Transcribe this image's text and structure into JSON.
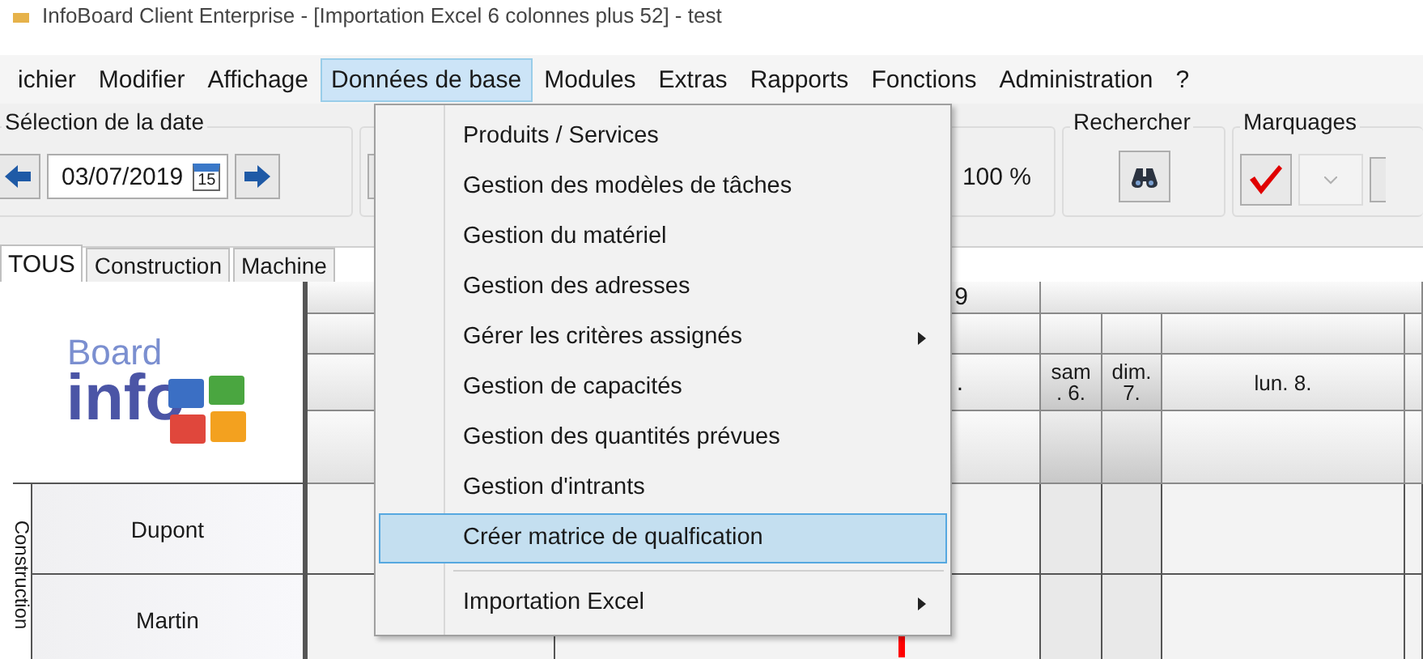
{
  "window": {
    "title": "InfoBoard Client Enterprise - [Importation Excel 6 colonnes plus 52] - test"
  },
  "menu_bar": [
    {
      "label": "ichier",
      "selected": false
    },
    {
      "label": "Modifier",
      "selected": false
    },
    {
      "label": "Affichage",
      "selected": false
    },
    {
      "label": "Données de base",
      "selected": true
    },
    {
      "label": "Modules",
      "selected": false
    },
    {
      "label": "Extras",
      "selected": false
    },
    {
      "label": "Rapports",
      "selected": false
    },
    {
      "label": "Fonctions",
      "selected": false
    },
    {
      "label": "Administration",
      "selected": false
    },
    {
      "label": "?",
      "selected": false
    }
  ],
  "toolbar": {
    "date_group": {
      "title": "Sélection de la date",
      "date": "03/07/2019",
      "calendar_day": "15"
    },
    "zoom": "100 %",
    "search_group": {
      "title": "Rechercher"
    },
    "marks_group": {
      "title": "Marquages"
    }
  },
  "tabs": [
    {
      "label": "TOUS",
      "selected": true
    },
    {
      "label": "Construction",
      "selected": false
    },
    {
      "label": "Machine",
      "selected": false
    }
  ],
  "logo": {
    "small": "Board",
    "large": "info"
  },
  "grid": {
    "month_label": "9",
    "days": [
      {
        "label": ".",
        "weekend": false
      },
      {
        "label": "sam\n. 6.",
        "weekend": true
      },
      {
        "label": "dim.\n7.",
        "weekend": true
      },
      {
        "label": "lun. 8.",
        "weekend": false
      }
    ],
    "group": "Construction",
    "rows": [
      {
        "name": "Dupont"
      },
      {
        "name": "Martin"
      }
    ]
  },
  "dropdown": [
    {
      "label": "Produits / Services",
      "kind": "item",
      "selected": false
    },
    {
      "label": "Gestion des modèles de tâches",
      "kind": "item",
      "selected": false
    },
    {
      "label": "Gestion du matériel",
      "kind": "item",
      "selected": false
    },
    {
      "label": "Gestion des adresses",
      "kind": "item",
      "selected": false
    },
    {
      "label": "Gérer les critères assignés",
      "kind": "submenu",
      "selected": false
    },
    {
      "label": "Gestion de capacités",
      "kind": "item",
      "selected": false
    },
    {
      "label": "Gestion des quantités prévues",
      "kind": "item",
      "selected": false
    },
    {
      "label": "Gestion d'intrants",
      "kind": "item",
      "selected": false
    },
    {
      "label": "Créer matrice de qualfication",
      "kind": "item",
      "selected": true
    },
    {
      "kind": "separator"
    },
    {
      "label": "Importation Excel",
      "kind": "submenu",
      "selected": false
    }
  ]
}
